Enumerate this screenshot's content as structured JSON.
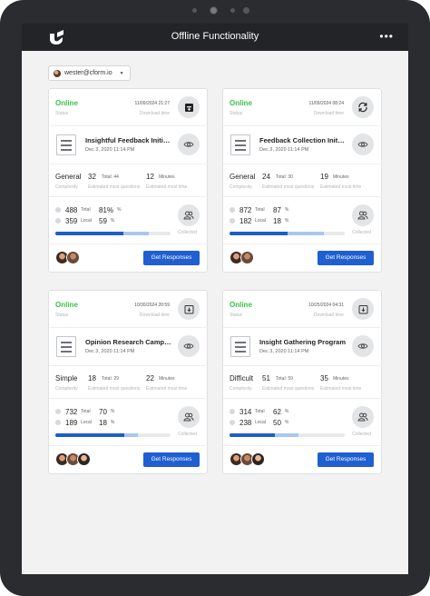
{
  "topbar": {
    "title": "Offline Functionality",
    "more_icon": "more-horizontal-icon"
  },
  "account": {
    "email": "wester@cform.io"
  },
  "labels": {
    "status_sub": "Status",
    "download_sub": "Download time",
    "complexity_sub": "Complexity",
    "questions_sub": "Estimated most questions",
    "minutes_sub": "Estimated most time",
    "total_word": "Total",
    "minutes_word": "Minutes",
    "local_word": "Local",
    "pct_sym": "%",
    "collected_sub": "Collected",
    "get_responses": "Get Responses"
  },
  "colors": {
    "online": "#38c24a",
    "primary": "#1f5fd1",
    "progress_light": "#a9c7ee"
  },
  "cards": [
    {
      "status": "Online",
      "download_time": "11/09/2024 21:27",
      "action_icon": "archive-icon",
      "title": "Insightful Feedback Initiative",
      "date": "Dec 3, 2020 11:14 PM",
      "complexity": "General",
      "questions": "32",
      "questions_total": "Total: 44",
      "minutes": "12",
      "total_count": "488",
      "total_pct": "81%",
      "local_count": "359",
      "local_pct": "59",
      "progress_local": 0.59,
      "progress_total": 0.81,
      "avatar_count": 2
    },
    {
      "status": "Online",
      "download_time": "11/09/2024 08:24",
      "action_icon": "sync-icon",
      "title": "Feedback Collection Initiative",
      "date": "Dec 3, 2020 11:14 PM",
      "complexity": "General",
      "questions": "24",
      "questions_total": "Total: 30",
      "minutes": "19",
      "total_count": "872",
      "total_pct": "87",
      "local_count": "182",
      "local_pct": "18",
      "progress_local": 0.5,
      "progress_total": 0.82,
      "avatar_count": 2
    },
    {
      "status": "Online",
      "download_time": "10/30/2024 20:59",
      "action_icon": "download-icon",
      "title": "Opinion Research Campaign",
      "date": "Dec 3, 2020 11:14 PM",
      "complexity": "Simple",
      "questions": "18",
      "questions_total": "Total: 29",
      "minutes": "22",
      "total_count": "732",
      "total_pct": "70",
      "local_count": "189",
      "local_pct": "18",
      "progress_local": 0.6,
      "progress_total": 0.72,
      "avatar_count": 3
    },
    {
      "status": "Online",
      "download_time": "10/25/2024 04:31",
      "action_icon": "download-icon",
      "title": "Insight Gathering Program",
      "date": "Dec 3, 2020 11:14 PM",
      "complexity": "Difficult",
      "questions": "51",
      "questions_total": "Total: 59",
      "minutes": "35",
      "total_count": "314",
      "total_pct": "62",
      "local_count": "238",
      "local_pct": "50",
      "progress_local": 0.39,
      "progress_total": 0.6,
      "avatar_count": 3
    }
  ]
}
